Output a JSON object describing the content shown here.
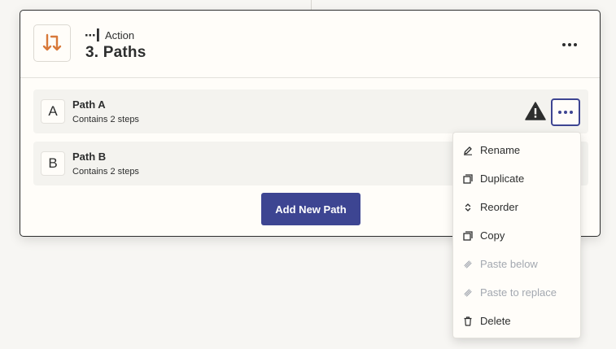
{
  "step": {
    "kind_label": "Action",
    "title": "3. Paths",
    "app_icon": "paths-arrows-icon",
    "accent_color": "#d8793a"
  },
  "paths": [
    {
      "letter": "A",
      "name": "Path A",
      "subtitle": "Contains 2 steps",
      "has_warning": true
    },
    {
      "letter": "B",
      "name": "Path B",
      "subtitle": "Contains 2 steps",
      "has_warning": false
    }
  ],
  "add_path_label": "Add New Path",
  "context_menu": {
    "items": [
      {
        "label": "Rename",
        "icon": "pencil-icon",
        "enabled": true
      },
      {
        "label": "Duplicate",
        "icon": "duplicate-icon",
        "enabled": true
      },
      {
        "label": "Reorder",
        "icon": "reorder-icon",
        "enabled": true
      },
      {
        "label": "Copy",
        "icon": "copy-icon",
        "enabled": true
      },
      {
        "label": "Paste below",
        "icon": "paste-icon",
        "enabled": false
      },
      {
        "label": "Paste to replace",
        "icon": "paste-icon",
        "enabled": false
      },
      {
        "label": "Delete",
        "icon": "trash-icon",
        "enabled": true
      }
    ]
  },
  "colors": {
    "primary": "#3d4592",
    "text": "#2d2e2e",
    "disabled_text": "#a3a8b0",
    "background": "#f7f6f3"
  }
}
